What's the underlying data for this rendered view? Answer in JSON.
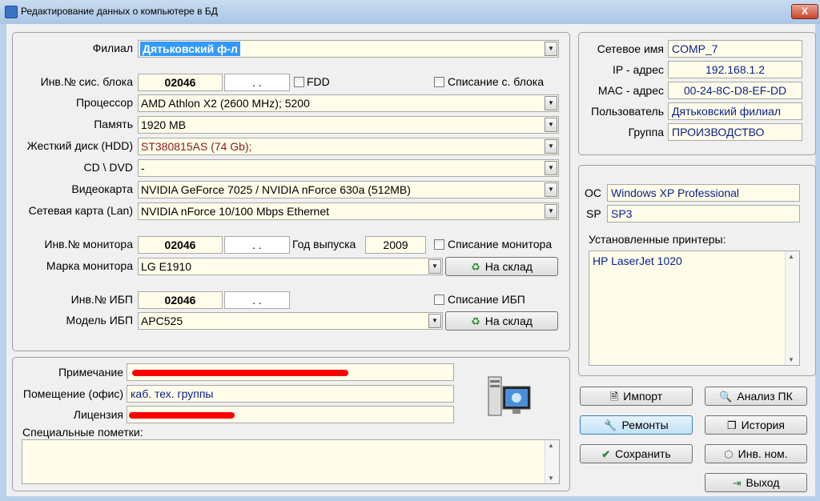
{
  "window": {
    "title": "Редактирование данных о компьютере в БД",
    "close": "X"
  },
  "hw": {
    "branch_label": "Филиал",
    "branch_value": "Дятьковский ф-л",
    "inv_block_label": "Инв.№ сис. блока",
    "inv_block_value": "02046",
    "inv_block_date": ".  .",
    "fdd_label": "FDD",
    "write_off_block_label": "Списание с. блока",
    "cpu_label": "Процессор",
    "cpu_value": "AMD Athlon X2 (2600 MHz); 5200",
    "ram_label": "Память",
    "ram_value": "1920 MB",
    "hdd_label": "Жесткий диск (HDD)",
    "hdd_value": "ST380815AS (74 Gb);",
    "cd_label": "CD \\ DVD",
    "cd_value": "-",
    "video_label": "Видеокарта",
    "video_value": "NVIDIA GeForce 7025 / NVIDIA nForce 630a (512MB)",
    "lan_label": "Сетевая карта (Lan)",
    "lan_value": "NVIDIA nForce 10/100 Mbps Ethernet",
    "inv_monitor_label": "Инв.№ монитора",
    "inv_monitor_value": "02046",
    "inv_monitor_date": ".  .",
    "year_label": "Год выпуска",
    "year_value": "2009",
    "write_off_monitor_label": "Списание монитора",
    "monitor_model_label": "Марка монитора",
    "monitor_model_value": "LG E1910",
    "to_stock_label": "На склад",
    "inv_ups_label": "Инв.№ ИБП",
    "inv_ups_value": "02046",
    "inv_ups_date": ".  .",
    "write_off_ups_label": "Списание ИБП",
    "ups_model_label": "Модель ИБП",
    "ups_model_value": "APC525"
  },
  "notes": {
    "note_label": "Примечание",
    "room_label": "Помещение (офис)",
    "room_value": "каб. тех. группы",
    "license_label": "Лицензия",
    "special_label": "Специальные пометки:"
  },
  "net": {
    "name_label": "Сетевое имя",
    "name_value": "COMP_7",
    "ip_label": "IP - адрес",
    "ip_value": "192.168.1.2",
    "mac_label": "MAC - адрес",
    "mac_value": "00-24-8C-D8-EF-DD",
    "user_label": "Пользователь",
    "user_value": "Дятьковский филиал",
    "group_label": "Группа",
    "group_value": "ПРОИЗВОДСТВО"
  },
  "os": {
    "os_label": "ОС",
    "os_value": "Windows XP Professional",
    "sp_label": "SP",
    "sp_value": "SP3",
    "printers_label": "Установленные принтеры:",
    "printers": [
      "HP LaserJet 1020"
    ]
  },
  "buttons": {
    "import": "Импорт",
    "analyze": "Анализ ПК",
    "repairs": "Ремонты",
    "history": "История",
    "save": "Сохранить",
    "inv_num": "Инв. ном.",
    "exit": "Выход"
  },
  "colors": {
    "field_bg": "#fffdea",
    "selection": "#3399ff",
    "value_blue": "#0a1f8a",
    "redaction": "#ff0000"
  }
}
